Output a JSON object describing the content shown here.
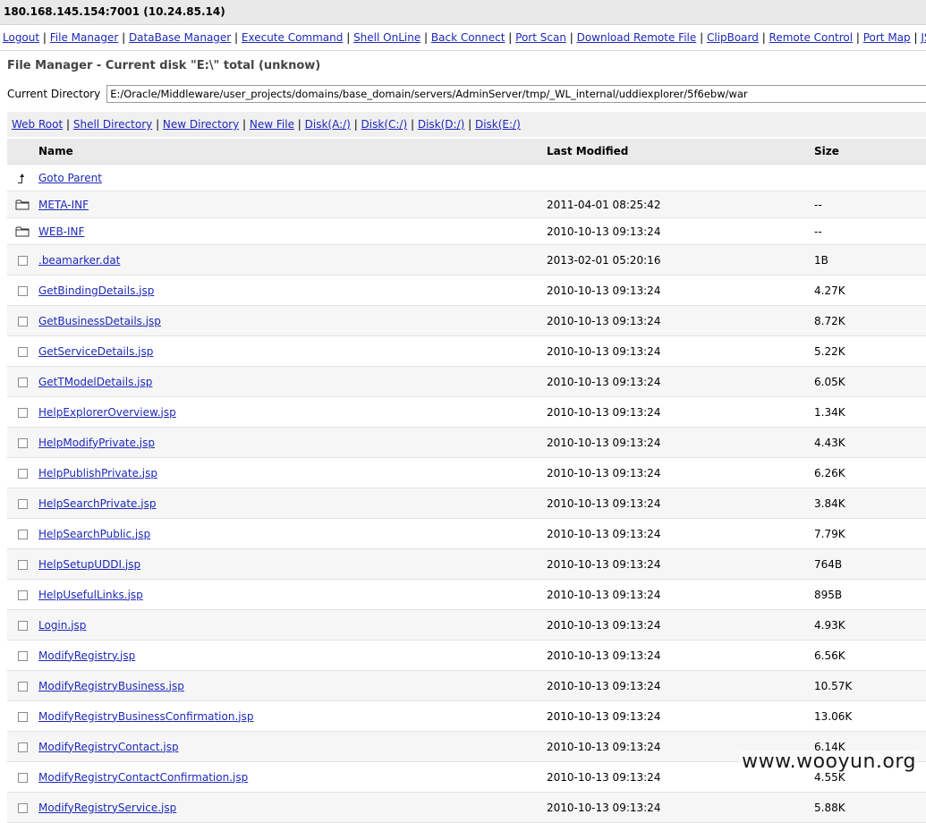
{
  "topbar": {
    "host": "180.168.145.154:7001 (10.24.85.14)"
  },
  "nav": [
    "Logout",
    "File Manager",
    "DataBase Manager",
    "Execute Command",
    "Shell OnLine",
    "Back Connect",
    "Port Scan",
    "Download Remote File",
    "ClipBoard",
    "Remote Control",
    "Port Map",
    "JSP Env"
  ],
  "section": {
    "title": "File Manager - Current disk \"E:\\\" total (unknow)"
  },
  "current_dir": {
    "label": "Current Directory",
    "value": "E:/Oracle/Middleware/user_projects/domains/base_domain/servers/AdminServer/tmp/_WL_internal/uddiexplorer/5f6ebw/war"
  },
  "disk_nav": [
    "Web Root",
    "Shell Directory",
    "New Directory",
    "New File",
    "Disk(A:/)",
    "Disk(C:/)",
    "Disk(D:/)",
    "Disk(E:/)"
  ],
  "table": {
    "headers": {
      "name": "Name",
      "modified": "Last Modified",
      "size": "Size"
    },
    "rows": [
      {
        "type": "up",
        "name": "Goto Parent",
        "modified": "",
        "size": ""
      },
      {
        "type": "folder",
        "name": "META-INF",
        "modified": "2011-04-01 08:25:42",
        "size": "--"
      },
      {
        "type": "folder",
        "name": "WEB-INF",
        "modified": "2010-10-13 09:13:24",
        "size": "--"
      },
      {
        "type": "file",
        "name": ".beamarker.dat",
        "modified": "2013-02-01 05:20:16",
        "size": "1B"
      },
      {
        "type": "file",
        "name": "GetBindingDetails.jsp",
        "modified": "2010-10-13 09:13:24",
        "size": "4.27K"
      },
      {
        "type": "file",
        "name": "GetBusinessDetails.jsp",
        "modified": "2010-10-13 09:13:24",
        "size": "8.72K"
      },
      {
        "type": "file",
        "name": "GetServiceDetails.jsp",
        "modified": "2010-10-13 09:13:24",
        "size": "5.22K"
      },
      {
        "type": "file",
        "name": "GetTModelDetails.jsp",
        "modified": "2010-10-13 09:13:24",
        "size": "6.05K"
      },
      {
        "type": "file",
        "name": "HelpExplorerOverview.jsp",
        "modified": "2010-10-13 09:13:24",
        "size": "1.34K"
      },
      {
        "type": "file",
        "name": "HelpModifyPrivate.jsp",
        "modified": "2010-10-13 09:13:24",
        "size": "4.43K"
      },
      {
        "type": "file",
        "name": "HelpPublishPrivate.jsp",
        "modified": "2010-10-13 09:13:24",
        "size": "6.26K"
      },
      {
        "type": "file",
        "name": "HelpSearchPrivate.jsp",
        "modified": "2010-10-13 09:13:24",
        "size": "3.84K"
      },
      {
        "type": "file",
        "name": "HelpSearchPublic.jsp",
        "modified": "2010-10-13 09:13:24",
        "size": "7.79K"
      },
      {
        "type": "file",
        "name": "HelpSetupUDDI.jsp",
        "modified": "2010-10-13 09:13:24",
        "size": "764B"
      },
      {
        "type": "file",
        "name": "HelpUsefulLinks.jsp",
        "modified": "2010-10-13 09:13:24",
        "size": "895B"
      },
      {
        "type": "file",
        "name": "Login.jsp",
        "modified": "2010-10-13 09:13:24",
        "size": "4.93K"
      },
      {
        "type": "file",
        "name": "ModifyRegistry.jsp",
        "modified": "2010-10-13 09:13:24",
        "size": "6.56K"
      },
      {
        "type": "file",
        "name": "ModifyRegistryBusiness.jsp",
        "modified": "2010-10-13 09:13:24",
        "size": "10.57K"
      },
      {
        "type": "file",
        "name": "ModifyRegistryBusinessConfirmation.jsp",
        "modified": "2010-10-13 09:13:24",
        "size": "13.06K"
      },
      {
        "type": "file",
        "name": "ModifyRegistryContact.jsp",
        "modified": "2010-10-13 09:13:24",
        "size": "6.14K"
      },
      {
        "type": "file",
        "name": "ModifyRegistryContactConfirmation.jsp",
        "modified": "2010-10-13 09:13:24",
        "size": "4.55K"
      },
      {
        "type": "file",
        "name": "ModifyRegistryService.jsp",
        "modified": "2010-10-13 09:13:24",
        "size": "5.88K"
      }
    ]
  },
  "watermark": "www.wooyun.org"
}
